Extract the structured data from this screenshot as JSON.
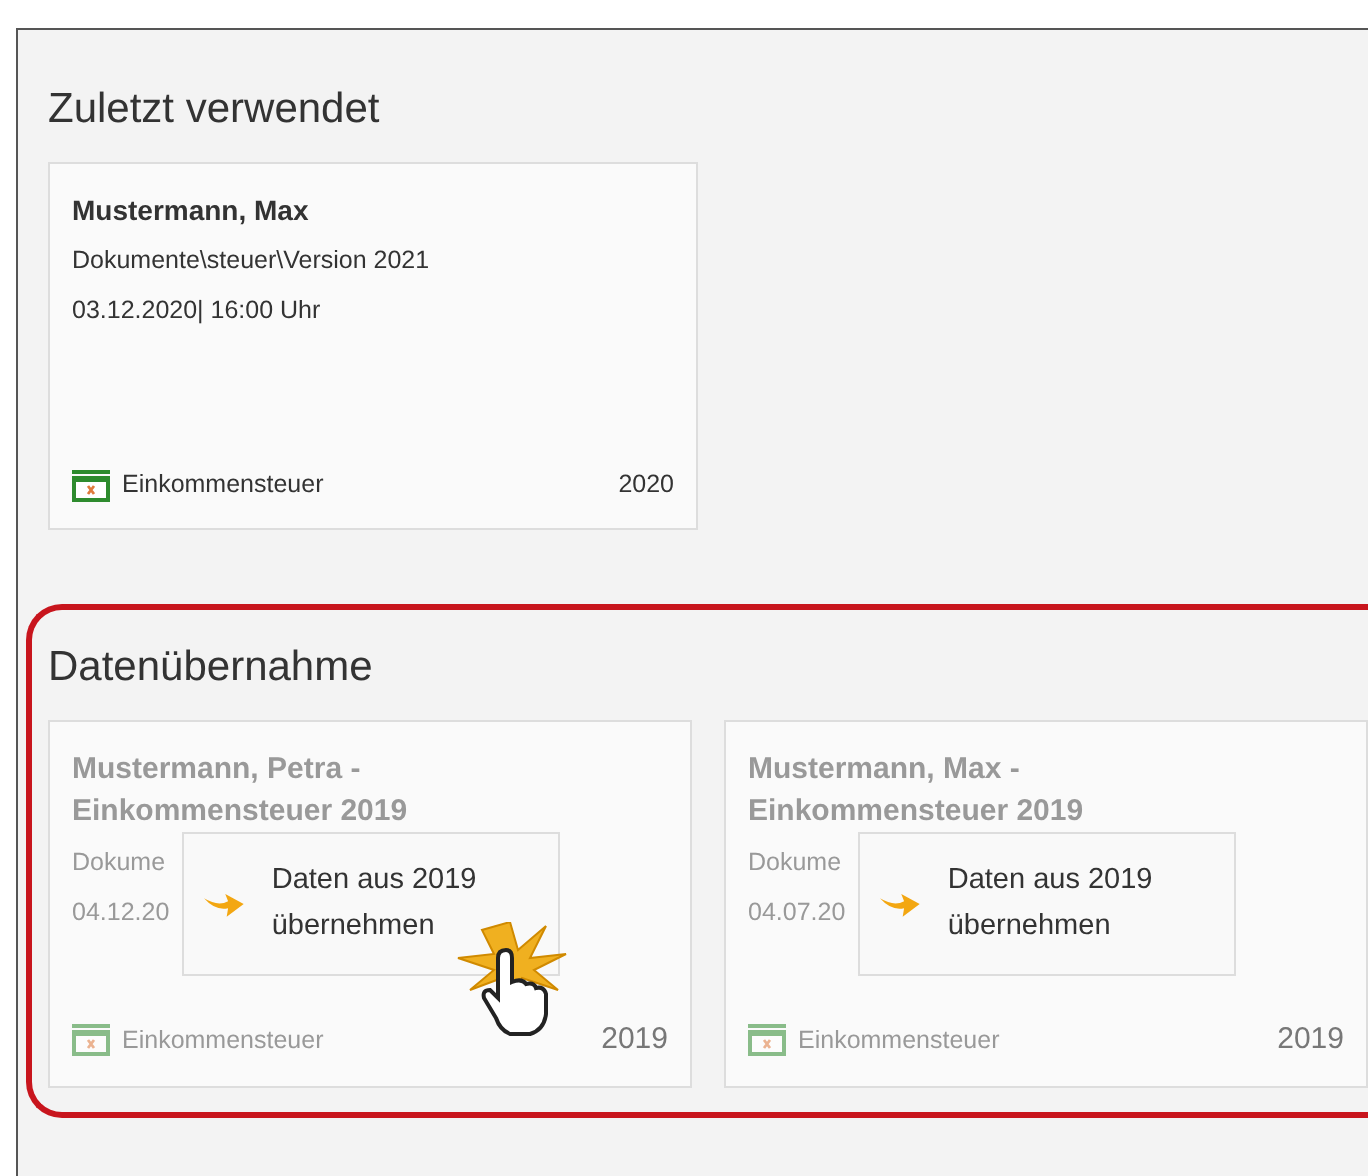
{
  "recent": {
    "title": "Zuletzt verwendet",
    "cards": [
      {
        "name": "Mustermann, Max",
        "path": "Dokumente\\steuer\\Version 2021",
        "date": "03.12.2020| 16:00 Uhr",
        "type": "Einkommensteuer",
        "year": "2020",
        "disabled": false
      }
    ]
  },
  "transfer": {
    "title": "Datenübernahme",
    "highlighted": true,
    "cards": [
      {
        "name": "Mustermann, Petra - Einkommensteuer 2019",
        "path": "Dokume",
        "date": "04.12.20",
        "type": "Einkommensteuer",
        "year": "2019",
        "disabled": true,
        "action": "Daten aus 2019 übernehmen",
        "hovered": true
      },
      {
        "name": "Mustermann, Max - Einkommensteuer 2019",
        "path": "Dokume",
        "date": "04.07.20",
        "type": "Einkommensteuer",
        "year": "2019",
        "disabled": true,
        "action": "Daten aus 2019 übernehmen",
        "hovered": false
      }
    ]
  }
}
